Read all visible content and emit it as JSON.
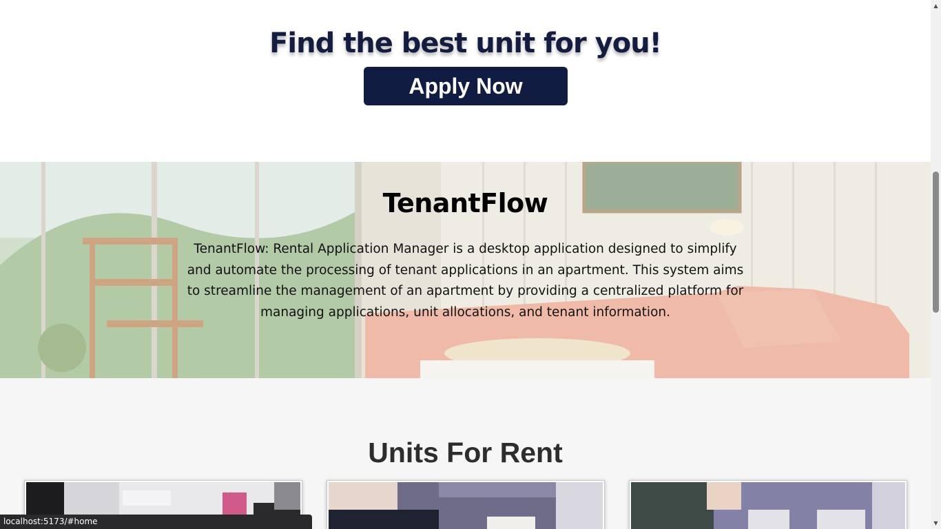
{
  "hero": {
    "title": "Find the best unit for you!",
    "apply_label": "Apply Now"
  },
  "about": {
    "title": "TenantFlow",
    "description": "TenantFlow: Rental Application Manager is a desktop application designed to simplify and automate the processing of tenant applications in an apartment. This system aims to streamline the management of an apartment by providing a centralized platform for managing applications, unit allocations, and tenant information."
  },
  "units": {
    "title": "Units For Rent",
    "cards": [
      {
        "image": "unit-photo-1"
      },
      {
        "image": "unit-photo-2"
      },
      {
        "image": "unit-photo-3"
      }
    ]
  },
  "status_bar": {
    "url": "localhost:5173/#home"
  },
  "colors": {
    "brand_navy": "#101c42",
    "units_bg": "#f6f6f6"
  }
}
